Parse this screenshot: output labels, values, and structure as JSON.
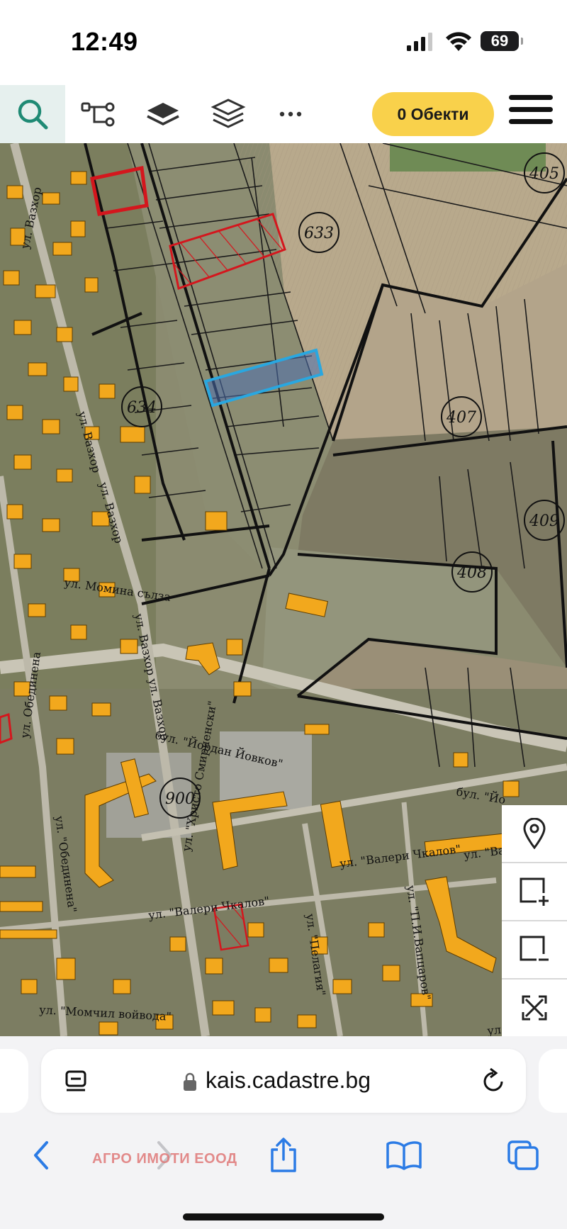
{
  "status_bar": {
    "time": "12:49",
    "battery": "69",
    "icons": [
      "cellular-signal-icon",
      "wifi-icon",
      "battery-icon"
    ]
  },
  "toolbar": {
    "tools": [
      "search-icon",
      "route-measure-icon",
      "layer-icon",
      "layers-stack-icon",
      "more-icon"
    ],
    "objects_button_label": "0 Обекти",
    "accent_color": "#1f8a74",
    "button_color": "#f9d14b"
  },
  "map": {
    "parcel_labels": [
      "405",
      "633",
      "634",
      "407",
      "409",
      "408",
      "900"
    ],
    "street_labels": [
      "ул. Вазхор",
      "ул. Вазхор",
      "ул. Вазхор",
      "ул. Момина сълза",
      "ул. Вазхор ул. Вазхор",
      "ул. Обединена",
      "бул. \"Йордан Йовков\"",
      "бул. \"Йо",
      "ул. \"Обединена\"",
      "ул. \"Христо Смирненски\"",
      "ул. \"Валери Чкалов\"",
      "ул. \"Валери Чкалов\"",
      "ул. \"Ва",
      "ул. \"Пелагия\"",
      "ул. \"П.И.Вапцаров\"",
      "ул. \"Момчил войвода\"",
      "ул. \"Ди"
    ],
    "highlight_colors": {
      "selected": "#29a7e0",
      "hatched": "#d4161d",
      "building": "#f2a81d"
    }
  },
  "side_controls": [
    "location-pin-icon",
    "select-add-icon",
    "select-remove-icon",
    "fit-extent-icon"
  ],
  "browser": {
    "url": "kais.cadastre.bg",
    "nav_icons": [
      "back-icon",
      "forward-icon",
      "share-icon",
      "bookmarks-icon",
      "tabs-icon"
    ],
    "watermark": "АГРО ИМОТИ ЕООД"
  }
}
